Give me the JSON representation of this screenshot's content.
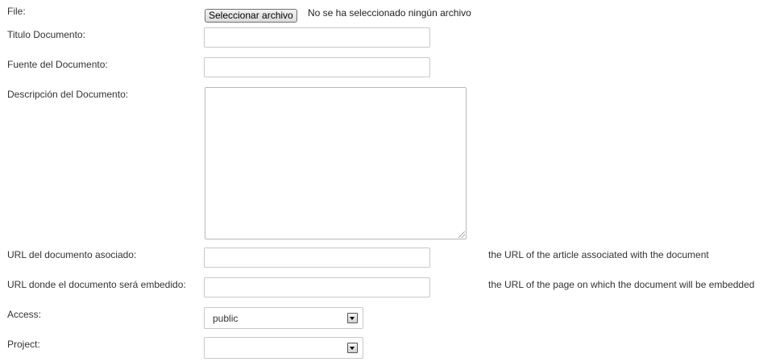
{
  "form": {
    "file": {
      "label": "File:",
      "button_label": "Seleccionar archivo",
      "status": "No se ha seleccionado ningún archivo"
    },
    "titulo": {
      "label": "Titulo Documento:",
      "value": ""
    },
    "fuente": {
      "label": "Fuente del Documento:",
      "value": ""
    },
    "descripcion": {
      "label": "Descripción del Documento:",
      "value": ""
    },
    "url_asociado": {
      "label": "URL del documento asociado:",
      "value": "",
      "hint": "the URL of the article associated with the document"
    },
    "url_embedido": {
      "label": "URL donde el documento será embedido:",
      "value": "",
      "hint": "the URL of the page on which the document will be embedded"
    },
    "access": {
      "label": "Access:",
      "selected": "public"
    },
    "project": {
      "label": "Project:",
      "selected": ""
    }
  },
  "icons": {
    "dropdown": "chevron-down-icon",
    "resize": "resize-grip-icon"
  }
}
